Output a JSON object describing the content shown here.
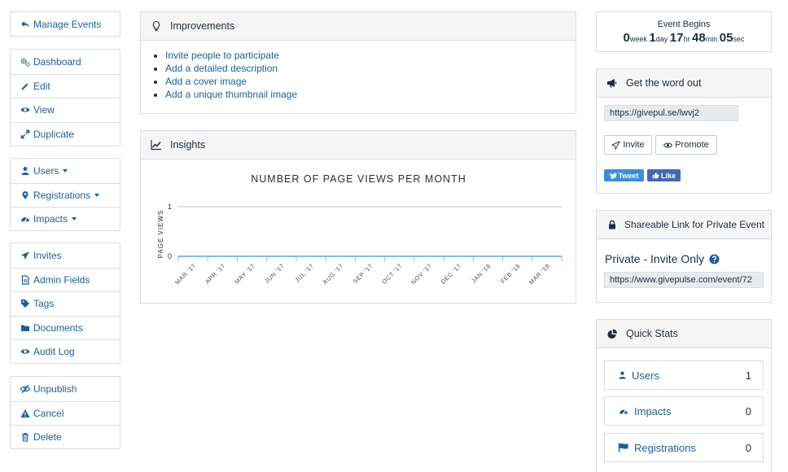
{
  "sidebar": {
    "top": {
      "label": "Manage Events"
    },
    "group1": [
      "Dashboard",
      "Edit",
      "View",
      "Duplicate"
    ],
    "group2": [
      "Users",
      "Registrations",
      "Impacts"
    ],
    "group3": [
      "Invites",
      "Admin Fields",
      "Tags",
      "Documents",
      "Audit Log"
    ],
    "group4": [
      "Unpublish",
      "Cancel",
      "Delete"
    ]
  },
  "improvements": {
    "title": "Improvements",
    "items": [
      "Invite people to participate",
      "Add a detailed description",
      "Add a cover image",
      "Add a unique thumbnail image"
    ]
  },
  "insights": {
    "title": "Insights"
  },
  "chart_data": {
    "type": "line",
    "title": "NUMBER OF PAGE VIEWS PER MONTH",
    "ylabel": "PAGE VIEWS",
    "xlabel": "",
    "categories": [
      "MAR '17",
      "APR '17",
      "MAY '17",
      "JUN '17",
      "JUL '17",
      "AUG '17",
      "SEP '17",
      "OCT '17",
      "NOV '17",
      "DEC '17",
      "JAN '18",
      "FEB '18",
      "MAR '18"
    ],
    "series": [
      {
        "values": [
          0,
          0,
          0,
          0,
          0,
          0,
          0,
          0,
          0,
          0,
          0,
          0,
          0
        ]
      }
    ],
    "ylim": [
      0,
      1
    ],
    "yticks": [
      "0",
      "1"
    ],
    "grid": true,
    "colors": {
      "line": "#8fb9dc",
      "grid": "#d3d6da"
    }
  },
  "countdown": {
    "label": "Event Begins",
    "weeks": "0",
    "weeks_unit": "week",
    "days": "1",
    "days_unit": "day",
    "hours": "17",
    "hours_unit": "hr",
    "minutes": "48",
    "minutes_unit": "min",
    "seconds": "05",
    "seconds_unit": "sec"
  },
  "share": {
    "title": "Get the word out",
    "short_url": "https://givepul.se/lwvj2",
    "invite_label": "Invite",
    "promote_label": "Promote",
    "tweet_label": "Tweet",
    "like_label": "Like"
  },
  "private_link": {
    "title": "Shareable Link for Private Event",
    "status": "Private - Invite Only",
    "url": "https://www.givepulse.com/event/72"
  },
  "quick_stats": {
    "title": "Quick Stats",
    "rows": [
      {
        "label": "Users",
        "count": "1"
      },
      {
        "label": "Impacts",
        "count": "0"
      },
      {
        "label": "Registrations",
        "count": "0"
      }
    ]
  },
  "colors": {
    "link": "#1f5f94",
    "border": "#d9dde2",
    "panel_head": "#f5f5f5",
    "twitter": "#3b8ed8",
    "facebook": "#4267b2"
  }
}
